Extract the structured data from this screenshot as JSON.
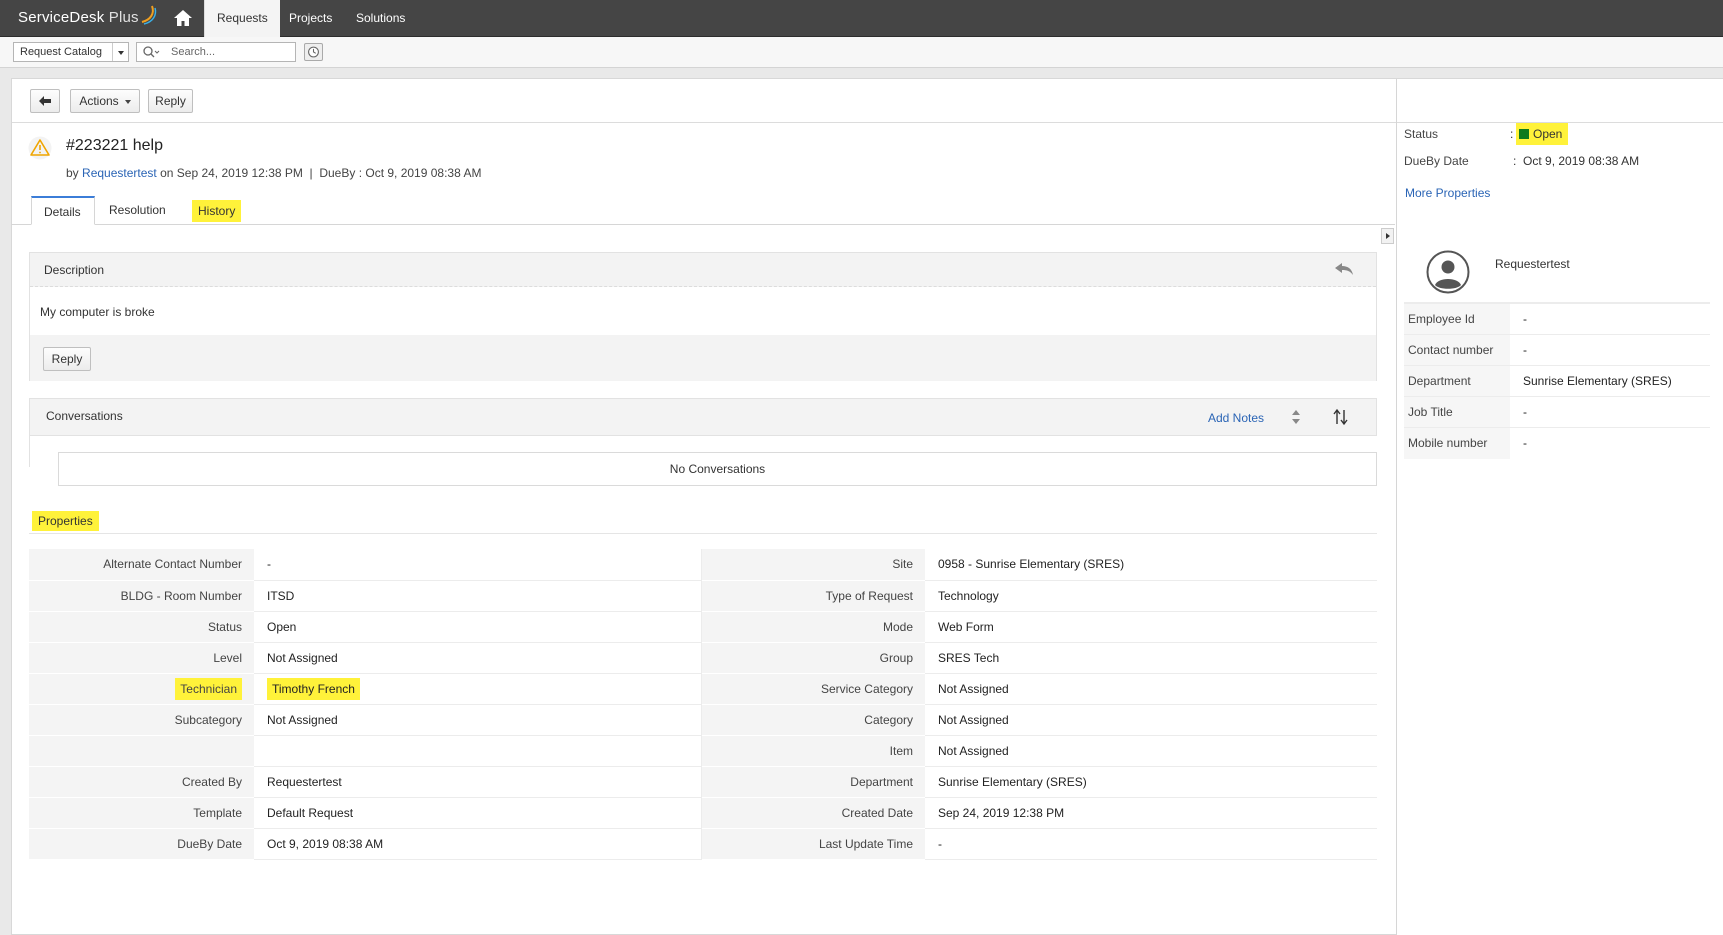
{
  "app": {
    "logo_text": "ServiceDesk",
    "logo_plus": "Plus",
    "nav": [
      {
        "label": "Requests"
      },
      {
        "label": "Projects"
      },
      {
        "label": "Solutions"
      }
    ]
  },
  "subbar": {
    "catalog_label": "Request Catalog",
    "search_placeholder": "Search..."
  },
  "actions": {
    "actions_label": "Actions",
    "reply_label": "Reply"
  },
  "request": {
    "title": "#223221  help",
    "by_prefix": "by",
    "requester": "Requestertest",
    "on_text": "on Sep 24, 2019 12:38 PM",
    "separator": "|",
    "dueby_text": "DueBy : Oct 9, 2019 08:38 AM"
  },
  "tabs": [
    {
      "label": "Details"
    },
    {
      "label": "Resolution"
    },
    {
      "label": "History"
    }
  ],
  "description": {
    "title": "Description",
    "text": "My computer is broke",
    "reply_label": "Reply"
  },
  "conversations": {
    "title": "Conversations",
    "add_notes": "Add Notes",
    "empty": "No Conversations"
  },
  "properties": {
    "title": "Properties",
    "rows": [
      {
        "l_label": "Alternate Contact Number",
        "l_value": "-",
        "r_label": "Site",
        "r_value": "0958 - Sunrise Elementary (SRES)"
      },
      {
        "l_label": "BLDG - Room Number",
        "l_value": "ITSD",
        "r_label": "Type of Request",
        "r_value": "Technology"
      },
      {
        "l_label": "Status",
        "l_value": "Open",
        "r_label": "Mode",
        "r_value": "Web Form"
      },
      {
        "l_label": "Level",
        "l_value": "Not Assigned",
        "r_label": "Group",
        "r_value": "SRES Tech"
      },
      {
        "l_label": "Technician",
        "l_value": "Timothy French",
        "r_label": "Service Category",
        "r_value": "Not Assigned"
      },
      {
        "l_label": "Subcategory",
        "l_value": "Not Assigned",
        "r_label": "Category",
        "r_value": "Not Assigned"
      },
      {
        "l_label": "",
        "l_value": "",
        "r_label": "Item",
        "r_value": "Not Assigned"
      },
      {
        "l_label": "Created By",
        "l_value": "Requestertest",
        "r_label": "Department",
        "r_value": "Sunrise Elementary (SRES)"
      },
      {
        "l_label": "Template",
        "l_value": "Default Request",
        "r_label": "Created Date",
        "r_value": "Sep 24, 2019 12:38 PM"
      },
      {
        "l_label": "DueBy Date",
        "l_value": "Oct 9, 2019 08:38 AM",
        "r_label": "Last Update Time",
        "r_value": "-"
      }
    ]
  },
  "side": {
    "status_label": "Status",
    "status_value": "Open",
    "dueby_label": "DueBy Date",
    "dueby_value": "Oct 9, 2019 08:38 AM",
    "colon": ":",
    "more_properties": "More Properties",
    "requester_name": "Requestertest",
    "info": [
      {
        "label": "Employee Id",
        "value": "-"
      },
      {
        "label": "Contact number",
        "value": "-"
      },
      {
        "label": "Department",
        "value": "Sunrise Elementary (SRES)"
      },
      {
        "label": "Job Title",
        "value": "-"
      },
      {
        "label": "Mobile number",
        "value": "-"
      }
    ]
  },
  "colors": {
    "topbar": "#454545",
    "link": "#2a64b5",
    "highlight": "#fff23a",
    "status_open": "#0d7a1d"
  }
}
